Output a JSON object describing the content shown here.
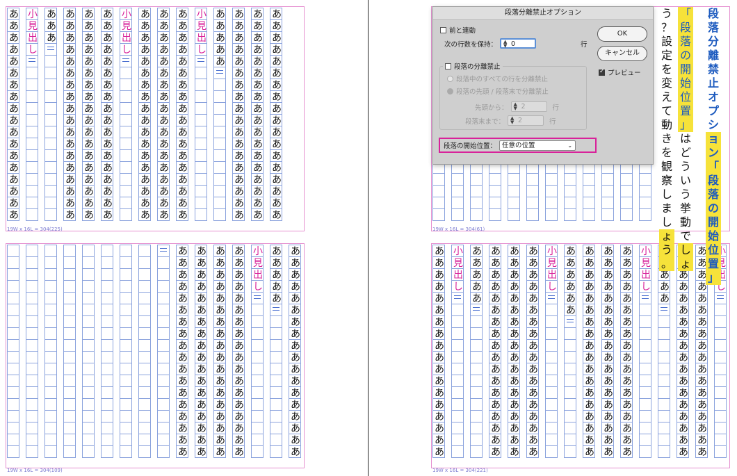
{
  "char": "あ",
  "heading_chars": [
    "小",
    "見",
    "出",
    "し"
  ],
  "left_top_label": "19W x 16L = 304(225)",
  "left_bottom_label": "19W x 16L = 304(109)",
  "right_top_label": "19W x 16L = 304(61)",
  "right_bottom_label": "19W x 16L = 304(221)",
  "dialog": {
    "title": "段落分離禁止オプション",
    "keep_with_prev": "前と連動",
    "keep_with_next_label": "次の行数を保持：",
    "keep_with_next_value": "0",
    "row_unit": "行",
    "keep_lines_together": "段落の分離禁止",
    "all_lines": "段落中のすべての行を分離禁止",
    "start_end": "段落の先頭 / 段落末で分離禁止",
    "start_label": "先頭から：",
    "start_value": "2",
    "end_label": "段落末まで：",
    "end_value": "2",
    "start_position_label": "段落の開始位置：",
    "start_position_value": "任意の位置",
    "ok": "OK",
    "cancel": "キャンセル",
    "preview": "プレビュー"
  },
  "heading_right": {
    "col1": [
      "段",
      "落",
      "分",
      "離",
      "禁",
      "止",
      "オ",
      "プ",
      "シ",
      "ョ",
      "ン",
      "「",
      "段",
      "落",
      "の",
      "開",
      "始",
      "位",
      "置",
      "」"
    ],
    "col2": [
      "「",
      "段",
      "落",
      "の",
      "開",
      "始",
      "位",
      "置",
      "」",
      "は",
      "ど",
      "う",
      "い",
      "う",
      "挙",
      "動",
      "で",
      "し",
      "ょ"
    ],
    "col3": [
      "う",
      "？",
      "設",
      "定",
      "を",
      "変",
      "え",
      "て",
      "動",
      "き",
      "を",
      "観",
      "察",
      "し",
      "ま",
      "し",
      "ょ",
      "う",
      "。"
    ]
  }
}
